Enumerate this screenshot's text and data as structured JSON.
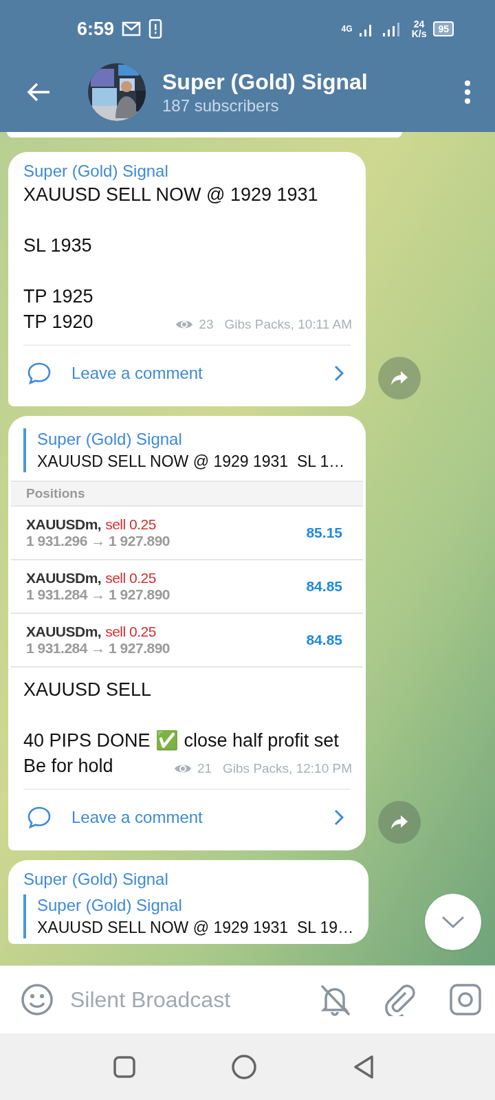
{
  "status_bar": {
    "time": "6:59",
    "network": "4G",
    "speed_value": "24",
    "speed_unit": "K/s",
    "battery": "95"
  },
  "header": {
    "title": "Super (Gold) Signal",
    "subtitle": "187 subscribers"
  },
  "messages": [
    {
      "sender": "Super (Gold) Signal",
      "paragraphs": [
        [
          "XAUUSD SELL NOW @ 1929 1931"
        ],
        [
          "SL 1935"
        ],
        [
          "TP 1925",
          "TP 1920"
        ]
      ],
      "views": "23",
      "meta": "Gibs Packs, 10:11 AM",
      "comment": "Leave a comment"
    },
    {
      "reply": {
        "sender": "Super (Gold) Signal",
        "text": "XAUUSD SELL NOW @ 1929 1931  SL 1…"
      },
      "screenshot": {
        "heading": "Positions",
        "positions": [
          {
            "symbol": "XAUUSDm,",
            "side": "sell 0.25",
            "prices": "1 931.296 → 1 927.890",
            "profit": "85.15"
          },
          {
            "symbol": "XAUUSDm,",
            "side": "sell 0.25",
            "prices": "1 931.284 → 1 927.890",
            "profit": "84.85"
          },
          {
            "symbol": "XAUUSDm,",
            "side": "sell 0.25",
            "prices": "1 931.284 → 1 927.890",
            "profit": "84.85"
          }
        ]
      },
      "paragraphs": [
        [
          "XAUUSD SELL"
        ],
        [
          "40 PIPS DONE ✅ close half profit set",
          "Be for hold"
        ]
      ],
      "views": "21",
      "meta": "Gibs Packs, 12:10 PM",
      "comment": "Leave a comment"
    },
    {
      "sender": "Super (Gold) Signal",
      "reply": {
        "sender": "Super (Gold) Signal",
        "text": "XAUUSD SELL NOW @ 1929 1931  SL 19…"
      }
    }
  ],
  "composer": {
    "placeholder": "Silent Broadcast"
  }
}
